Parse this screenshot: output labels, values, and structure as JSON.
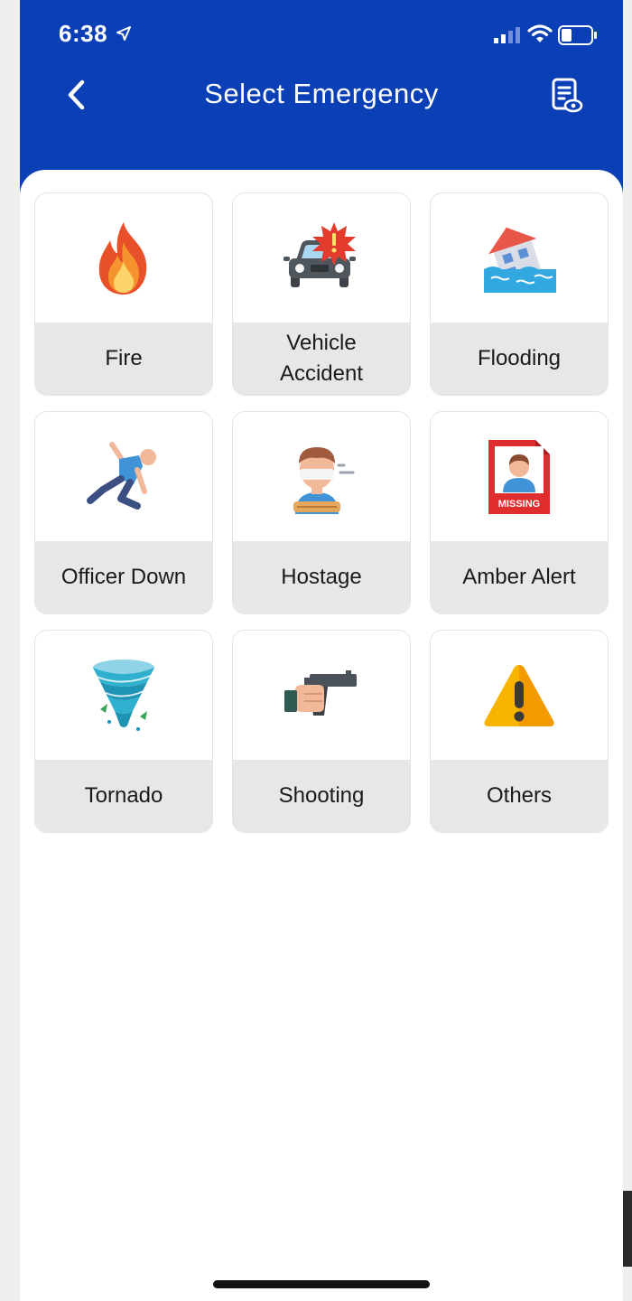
{
  "status": {
    "time": "6:38"
  },
  "header": {
    "title": "Select Emergency",
    "back_icon": "chevron-left-icon",
    "action_icon": "report-view-icon",
    "bg_color": "#0a3fb5"
  },
  "emergencies": [
    {
      "label": "Fire",
      "icon": "fire-icon"
    },
    {
      "label": "Vehicle\nAccident",
      "icon": "vehicle-accident-icon"
    },
    {
      "label": "Flooding",
      "icon": "flooding-icon"
    },
    {
      "label": "Officer Down",
      "icon": "officer-down-icon"
    },
    {
      "label": "Hostage",
      "icon": "hostage-icon"
    },
    {
      "label": "Amber Alert",
      "icon": "missing-poster-icon",
      "badge": "MISSING"
    },
    {
      "label": "Tornado",
      "icon": "tornado-icon"
    },
    {
      "label": "Shooting",
      "icon": "gun-icon"
    },
    {
      "label": "Others",
      "icon": "warning-icon"
    }
  ]
}
